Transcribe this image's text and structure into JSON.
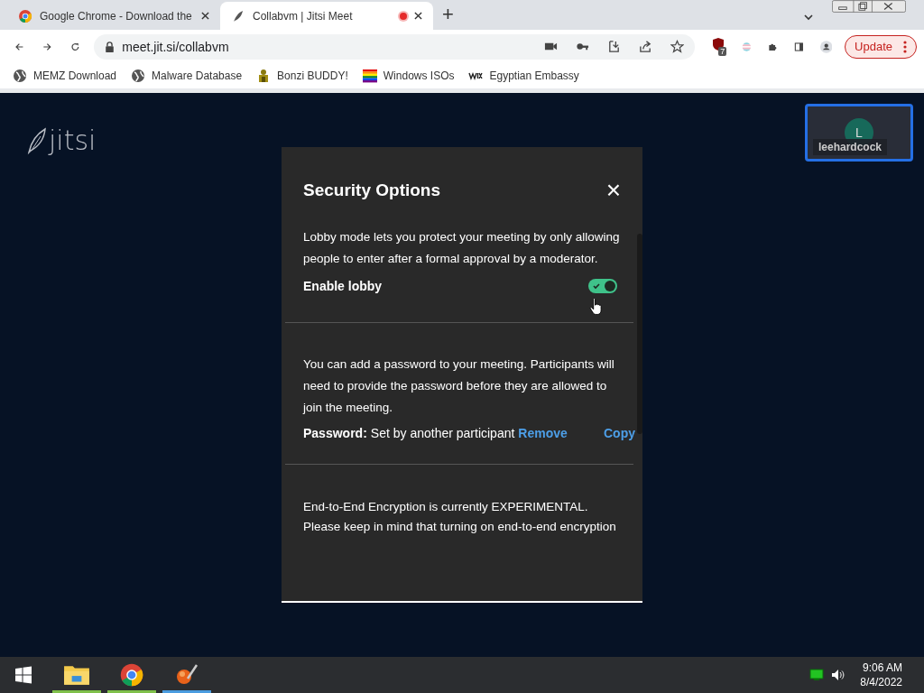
{
  "browser": {
    "tabs": [
      {
        "title": "Google Chrome - Download the",
        "selected": false,
        "recording": false
      },
      {
        "title": "Collabvm | Jitsi Meet",
        "selected": true,
        "recording": true
      }
    ],
    "new_tab": "+",
    "address": "meet.jit.si/collabvm",
    "update_button": "Update",
    "extension_badge": "7",
    "bookmarks": [
      {
        "label": "MEMZ Download"
      },
      {
        "label": "Malware Database"
      },
      {
        "label": "Bonzi BUDDY!"
      },
      {
        "label": "Windows ISOs"
      },
      {
        "label": "Egyptian Embassy"
      }
    ]
  },
  "meeting": {
    "logo": "jitsi",
    "participant": {
      "initial": "L",
      "name": "leehardcock"
    }
  },
  "dialog": {
    "title": "Security Options",
    "close": "×",
    "lobby": {
      "description": "Lobby mode lets you protect your meeting by only allowing people to enter after a formal approval by a moderator.",
      "label": "Enable lobby",
      "on": true
    },
    "password": {
      "description": "You can add a password to your meeting. Participants will need to provide the password before they are allowed to join the meeting.",
      "label": "Password:",
      "value": "Set by another participant",
      "remove": "Remove",
      "copy": "Copy"
    },
    "e2ee": {
      "lines": [
        "End-to-End Encryption is currently EXPERIMENTAL.",
        "Please keep in mind that turning on end-to-end encryption"
      ]
    }
  },
  "taskbar": {
    "time": "9:06 AM",
    "date": "8/4/2022"
  }
}
